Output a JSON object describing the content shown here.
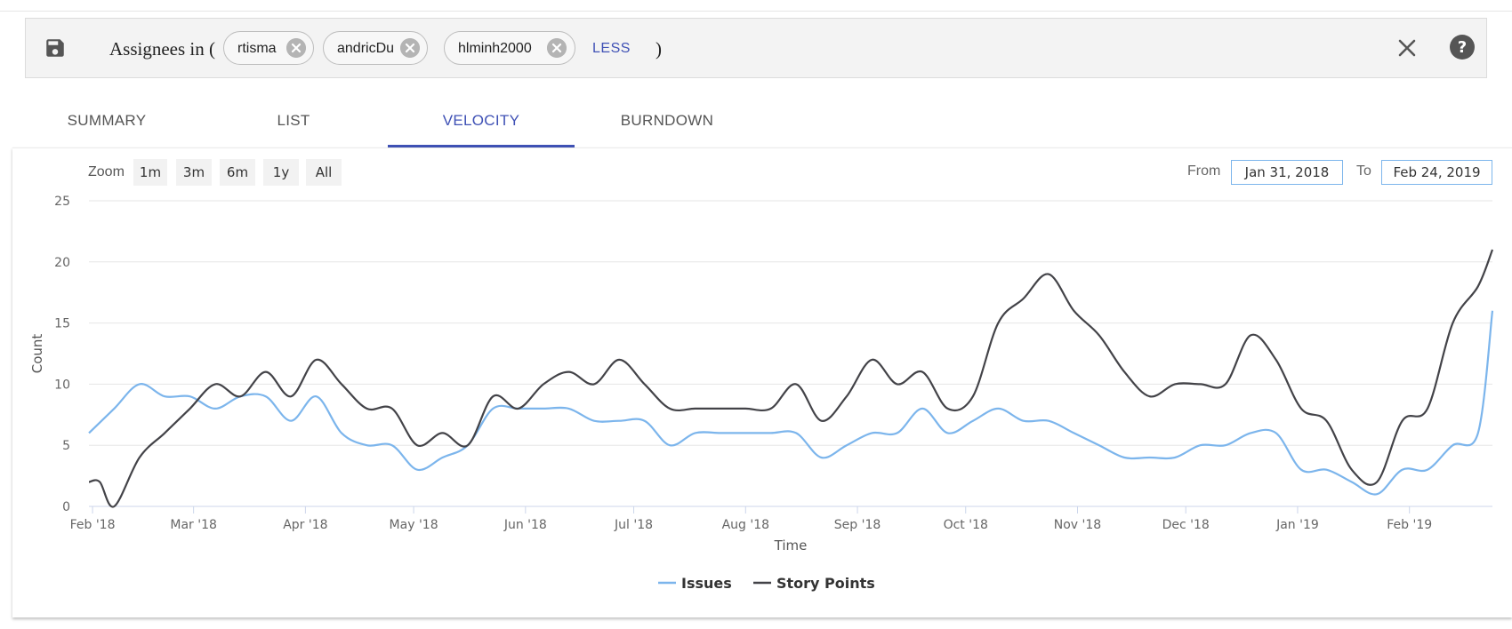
{
  "filter": {
    "label": "Assignees in (",
    "chips": [
      "rtisma",
      "andricDu",
      "hlminh2000"
    ],
    "less_label": "LESS",
    "close_paren": ")"
  },
  "icons": {
    "save": "save-icon",
    "chip_remove": "remove-circle-icon",
    "clear": "close-icon",
    "help": "help-icon"
  },
  "tabs": [
    {
      "label": "SUMMARY",
      "active": false
    },
    {
      "label": "LIST",
      "active": false
    },
    {
      "label": "VELOCITY",
      "active": true
    },
    {
      "label": "BURNDOWN",
      "active": false
    }
  ],
  "controls": {
    "zoom_label": "Zoom",
    "zoom_buttons": [
      "1m",
      "3m",
      "6m",
      "1y",
      "All"
    ],
    "from_label": "From",
    "from_value": "Jan 31, 2018",
    "to_label": "To",
    "to_value": "Feb 24, 2019"
  },
  "colors": {
    "accent": "#3f51b5",
    "issues": "#7cb5ec",
    "story_points": "#434348"
  },
  "chart_data": {
    "type": "line",
    "xlabel": "Time",
    "ylabel": "Count",
    "ylim": [
      0,
      25
    ],
    "xlim": [
      "2018-01-31",
      "2019-02-24"
    ],
    "y_ticks": [
      "0",
      "5",
      "10",
      "15",
      "20",
      "25"
    ],
    "x_ticks": [
      {
        "date": "2018-02-01",
        "label": "Feb '18"
      },
      {
        "date": "2018-03-01",
        "label": "Mar '18"
      },
      {
        "date": "2018-04-01",
        "label": "Apr '18"
      },
      {
        "date": "2018-05-01",
        "label": "May '18"
      },
      {
        "date": "2018-06-01",
        "label": "Jun '18"
      },
      {
        "date": "2018-07-01",
        "label": "Jul '18"
      },
      {
        "date": "2018-08-01",
        "label": "Aug '18"
      },
      {
        "date": "2018-09-01",
        "label": "Sep '18"
      },
      {
        "date": "2018-10-01",
        "label": "Oct '18"
      },
      {
        "date": "2018-11-01",
        "label": "Nov '18"
      },
      {
        "date": "2018-12-01",
        "label": "Dec '18"
      },
      {
        "date": "2019-01-01",
        "label": "Jan '19"
      },
      {
        "date": "2019-02-01",
        "label": "Feb '19"
      }
    ],
    "grid": true,
    "legend": "bottom-center",
    "series": [
      {
        "name": "Issues",
        "color": "#7cb5ec",
        "points": [
          [
            "2018-01-31",
            6
          ],
          [
            "2018-02-07",
            8
          ],
          [
            "2018-02-14",
            10
          ],
          [
            "2018-02-21",
            9
          ],
          [
            "2018-02-28",
            9
          ],
          [
            "2018-03-07",
            8
          ],
          [
            "2018-03-14",
            9
          ],
          [
            "2018-03-21",
            9
          ],
          [
            "2018-03-28",
            7
          ],
          [
            "2018-04-04",
            9
          ],
          [
            "2018-04-11",
            6
          ],
          [
            "2018-04-18",
            5
          ],
          [
            "2018-04-25",
            5
          ],
          [
            "2018-05-02",
            3
          ],
          [
            "2018-05-09",
            4
          ],
          [
            "2018-05-16",
            5
          ],
          [
            "2018-05-23",
            8
          ],
          [
            "2018-05-30",
            8
          ],
          [
            "2018-06-06",
            8
          ],
          [
            "2018-06-13",
            8
          ],
          [
            "2018-06-20",
            7
          ],
          [
            "2018-06-27",
            7
          ],
          [
            "2018-07-04",
            7
          ],
          [
            "2018-07-11",
            5
          ],
          [
            "2018-07-18",
            6
          ],
          [
            "2018-07-25",
            6
          ],
          [
            "2018-08-01",
            6
          ],
          [
            "2018-08-08",
            6
          ],
          [
            "2018-08-15",
            6
          ],
          [
            "2018-08-22",
            4
          ],
          [
            "2018-08-29",
            5
          ],
          [
            "2018-09-05",
            6
          ],
          [
            "2018-09-12",
            6
          ],
          [
            "2018-09-19",
            8
          ],
          [
            "2018-09-26",
            6
          ],
          [
            "2018-10-03",
            7
          ],
          [
            "2018-10-10",
            8
          ],
          [
            "2018-10-17",
            7
          ],
          [
            "2018-10-24",
            7
          ],
          [
            "2018-10-31",
            6
          ],
          [
            "2018-11-07",
            5
          ],
          [
            "2018-11-14",
            4
          ],
          [
            "2018-11-21",
            4
          ],
          [
            "2018-11-28",
            4
          ],
          [
            "2018-12-05",
            5
          ],
          [
            "2018-12-12",
            5
          ],
          [
            "2018-12-19",
            6
          ],
          [
            "2018-12-26",
            6
          ],
          [
            "2019-01-02",
            3
          ],
          [
            "2019-01-09",
            3
          ],
          [
            "2019-01-16",
            2
          ],
          [
            "2019-01-23",
            1
          ],
          [
            "2019-01-30",
            3
          ],
          [
            "2019-02-06",
            3
          ],
          [
            "2019-02-13",
            5
          ],
          [
            "2019-02-20",
            6
          ],
          [
            "2019-02-24",
            16
          ]
        ]
      },
      {
        "name": "Story Points",
        "color": "#434348",
        "points": [
          [
            "2018-01-31",
            2
          ],
          [
            "2018-02-03",
            2
          ],
          [
            "2018-02-07",
            0
          ],
          [
            "2018-02-14",
            4
          ],
          [
            "2018-02-21",
            6
          ],
          [
            "2018-02-28",
            8
          ],
          [
            "2018-03-07",
            10
          ],
          [
            "2018-03-14",
            9
          ],
          [
            "2018-03-21",
            11
          ],
          [
            "2018-03-28",
            9
          ],
          [
            "2018-04-04",
            12
          ],
          [
            "2018-04-11",
            10
          ],
          [
            "2018-04-18",
            8
          ],
          [
            "2018-04-25",
            8
          ],
          [
            "2018-05-02",
            5
          ],
          [
            "2018-05-09",
            6
          ],
          [
            "2018-05-16",
            5
          ],
          [
            "2018-05-23",
            9
          ],
          [
            "2018-05-30",
            8
          ],
          [
            "2018-06-06",
            10
          ],
          [
            "2018-06-13",
            11
          ],
          [
            "2018-06-20",
            10
          ],
          [
            "2018-06-27",
            12
          ],
          [
            "2018-07-04",
            10
          ],
          [
            "2018-07-11",
            8
          ],
          [
            "2018-07-18",
            8
          ],
          [
            "2018-07-25",
            8
          ],
          [
            "2018-08-01",
            8
          ],
          [
            "2018-08-08",
            8
          ],
          [
            "2018-08-15",
            10
          ],
          [
            "2018-08-22",
            7
          ],
          [
            "2018-08-29",
            9
          ],
          [
            "2018-09-05",
            12
          ],
          [
            "2018-09-12",
            10
          ],
          [
            "2018-09-19",
            11
          ],
          [
            "2018-09-26",
            8
          ],
          [
            "2018-10-03",
            9
          ],
          [
            "2018-10-10",
            15
          ],
          [
            "2018-10-17",
            17
          ],
          [
            "2018-10-24",
            19
          ],
          [
            "2018-10-31",
            16
          ],
          [
            "2018-11-07",
            14
          ],
          [
            "2018-11-14",
            11
          ],
          [
            "2018-11-21",
            9
          ],
          [
            "2018-11-28",
            10
          ],
          [
            "2018-12-05",
            10
          ],
          [
            "2018-12-12",
            10
          ],
          [
            "2018-12-19",
            14
          ],
          [
            "2018-12-26",
            12
          ],
          [
            "2019-01-02",
            8
          ],
          [
            "2019-01-09",
            7
          ],
          [
            "2019-01-16",
            3
          ],
          [
            "2019-01-23",
            2
          ],
          [
            "2019-01-30",
            7
          ],
          [
            "2019-02-06",
            8
          ],
          [
            "2019-02-13",
            15
          ],
          [
            "2019-02-20",
            18
          ],
          [
            "2019-02-24",
            21
          ]
        ]
      }
    ]
  }
}
